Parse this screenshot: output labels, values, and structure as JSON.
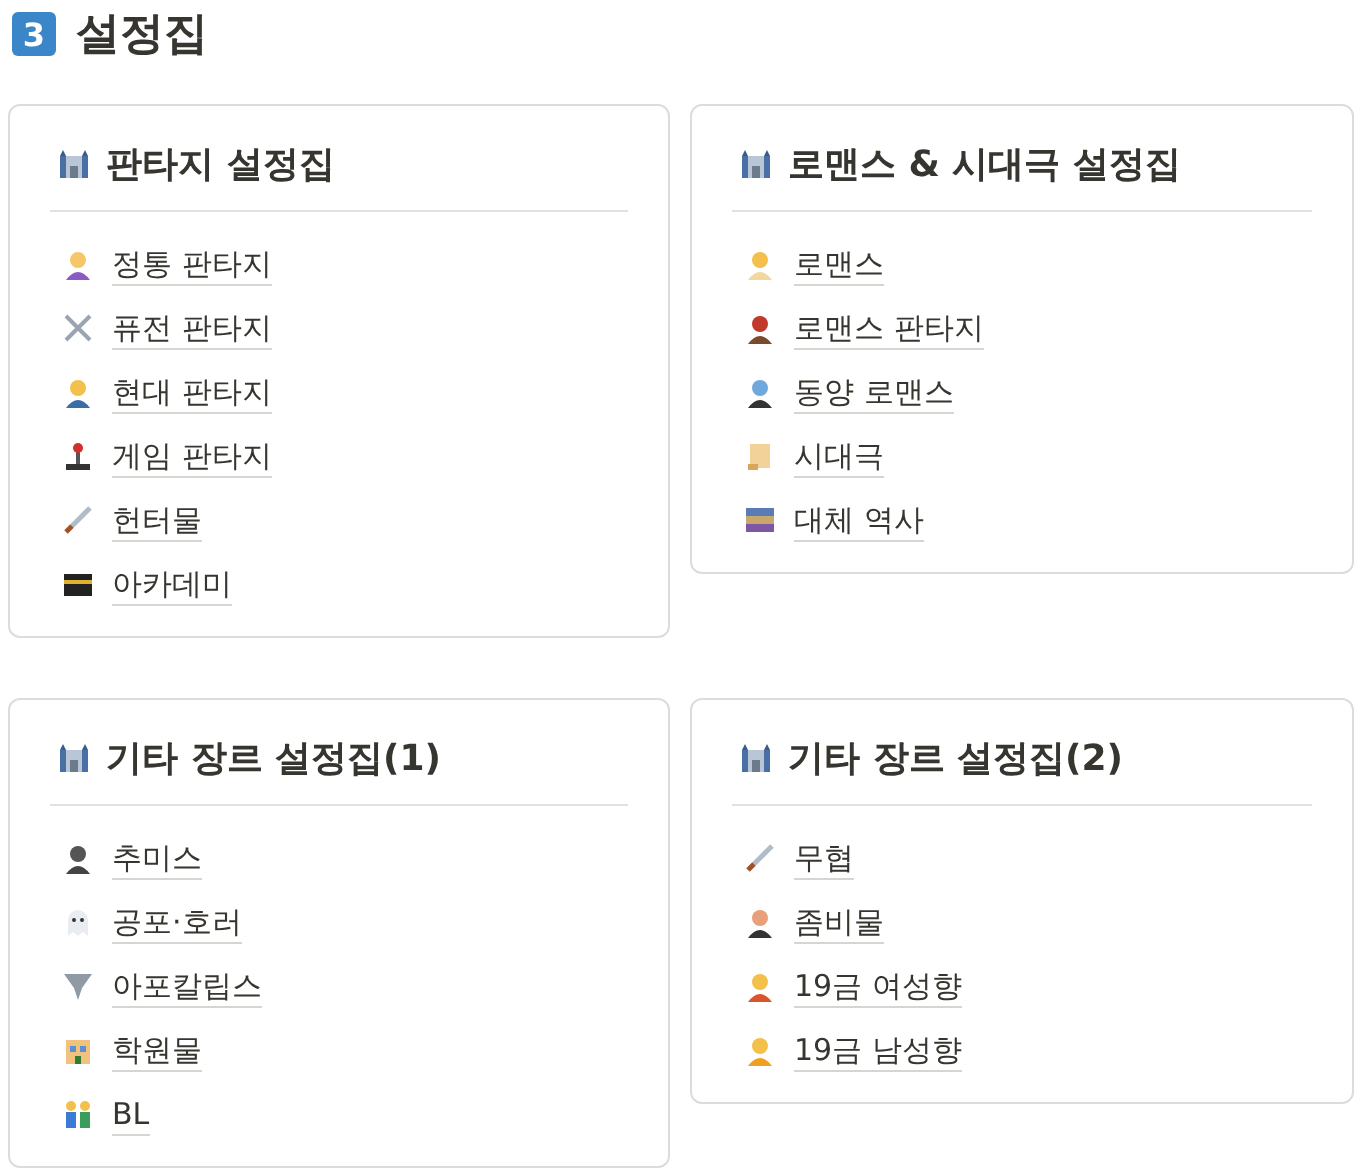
{
  "heading": {
    "number": "3",
    "title": "설정집"
  },
  "cards": [
    {
      "title": "판타지 설정집",
      "links": [
        "정통 판타지",
        "퓨전 판타지",
        "현대 판타지",
        "게임 판타지",
        "헌터물",
        "아카데미"
      ]
    },
    {
      "title": "로맨스 & 시대극 설정집",
      "links": [
        "로맨스",
        "로맨스 판타지",
        "동양 로맨스",
        "시대극",
        "대체 역사"
      ]
    },
    {
      "title": "기타 장르 설정집(1)",
      "links": [
        "추미스",
        "공포·호러",
        "아포칼립스",
        "학원물",
        "BL"
      ]
    },
    {
      "title": "기타 장르 설정집(2)",
      "links": [
        "무협",
        "좀비물",
        "19금 여성향",
        "19금 남성향"
      ]
    }
  ]
}
